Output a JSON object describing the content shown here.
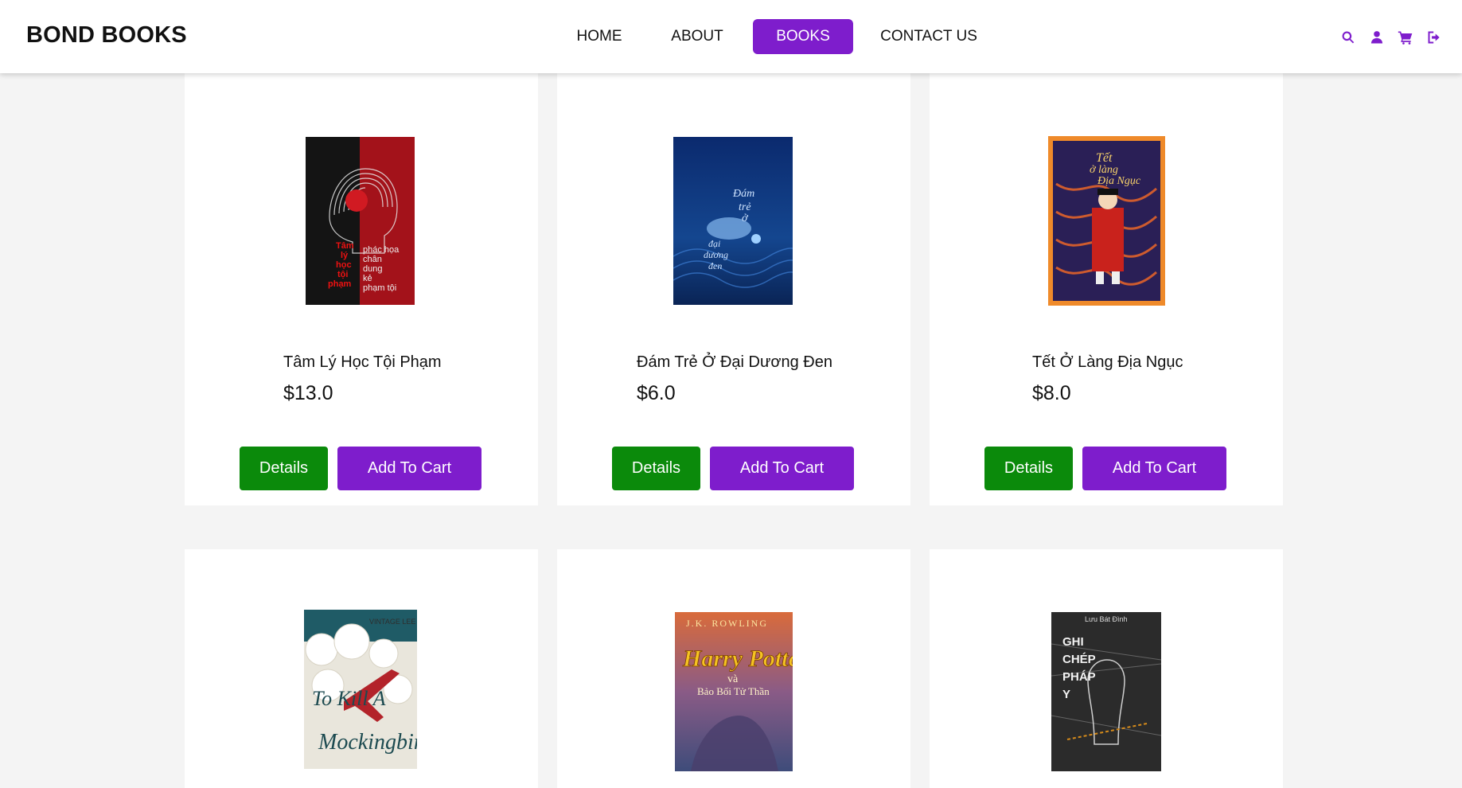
{
  "brand": "BOND BOOKS",
  "nav": {
    "home": "HOME",
    "about": "ABOUT",
    "books": "BOOKS",
    "contact": "CONTACT US",
    "active": "BOOKS"
  },
  "icons": [
    "search-icon",
    "user-icon",
    "cart-icon",
    "logout-icon"
  ],
  "colors": {
    "accent": "#7e1dcc",
    "details_button": "#0b8a0b",
    "background": "#f4f4f4"
  },
  "buttons": {
    "details": "Details",
    "add_to_cart": "Add To Cart"
  },
  "books": [
    {
      "title": "Tâm Lý Học Tội Phạm",
      "price": "$13.0"
    },
    {
      "title": "Đám Trẻ Ở Đại Dương Đen",
      "price": "$6.0"
    },
    {
      "title": "Tết Ở Làng Địa Ngục",
      "price": "$8.0"
    },
    {
      "title": "",
      "price": ""
    },
    {
      "title": "",
      "price": ""
    },
    {
      "title": "",
      "price": ""
    }
  ]
}
